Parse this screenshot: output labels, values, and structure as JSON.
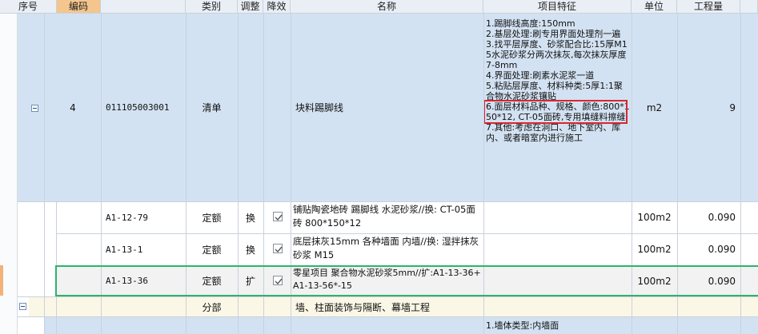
{
  "columns": [
    "序号",
    "编码",
    "类别",
    "调整",
    "降效",
    "名称",
    "项目特征",
    "单位",
    "工程量"
  ],
  "main_row": {
    "seq": "4",
    "code": "011105003001",
    "category": "清单",
    "name": "块料踢脚线",
    "unit": "m2",
    "quantity": "9",
    "features": [
      "1.踢脚线高度:150mm",
      "2.基层处理:刷专用界面处理剂一遍",
      "3.找平层厚度、砂浆配合比:15厚M15水泥砂浆分两次抹灰,每次抹灰厚度7-8mm",
      "4.界面处理:刷素水泥浆一道",
      "5.粘贴层厚度、材料种类:5厚1:1聚合物水泥砂浆镶贴",
      "6.面层材料品种、规格、颜色:800*150*12, CT-05面砖,专用填缝料擦缝",
      "7.其他:考虑在洞口、地下室内、库内、或者暗室内进行施工"
    ]
  },
  "sub_rows": [
    {
      "code": "A1-12-79",
      "category": "定额",
      "adjust": "换",
      "name": "铺贴陶瓷地砖 踢脚线 水泥砂浆//换: CT-05面砖 800*150*12",
      "unit": "100m2",
      "quantity": "0.090"
    },
    {
      "code": "A1-13-1",
      "category": "定额",
      "adjust": "换",
      "name": "底层抹灰15mm 各种墙面 内墙//换: 湿拌抹灰砂浆 M15",
      "unit": "100m2",
      "quantity": "0.090"
    },
    {
      "code": "A1-13-36",
      "category": "定额",
      "adjust": "扩",
      "name": "零星项目 聚合物水泥砂浆5mm//扩:A1-13-36+A1-13-56*-15",
      "unit": "100m2",
      "quantity": "0.090"
    }
  ],
  "section_row": {
    "category": "分部",
    "name": "墙、柱面装饰与隔断、幕墙工程"
  },
  "next_row": {
    "feature": "1.墙体类型:内墙面"
  },
  "colors": {
    "header_bg": "#eaeff6",
    "code_header": "#f4c58d",
    "selected_row": "#d3e2f2",
    "section_row": "#fbf7e6",
    "highlight_border": "#d9262e",
    "focus_border": "#2fb36b"
  }
}
